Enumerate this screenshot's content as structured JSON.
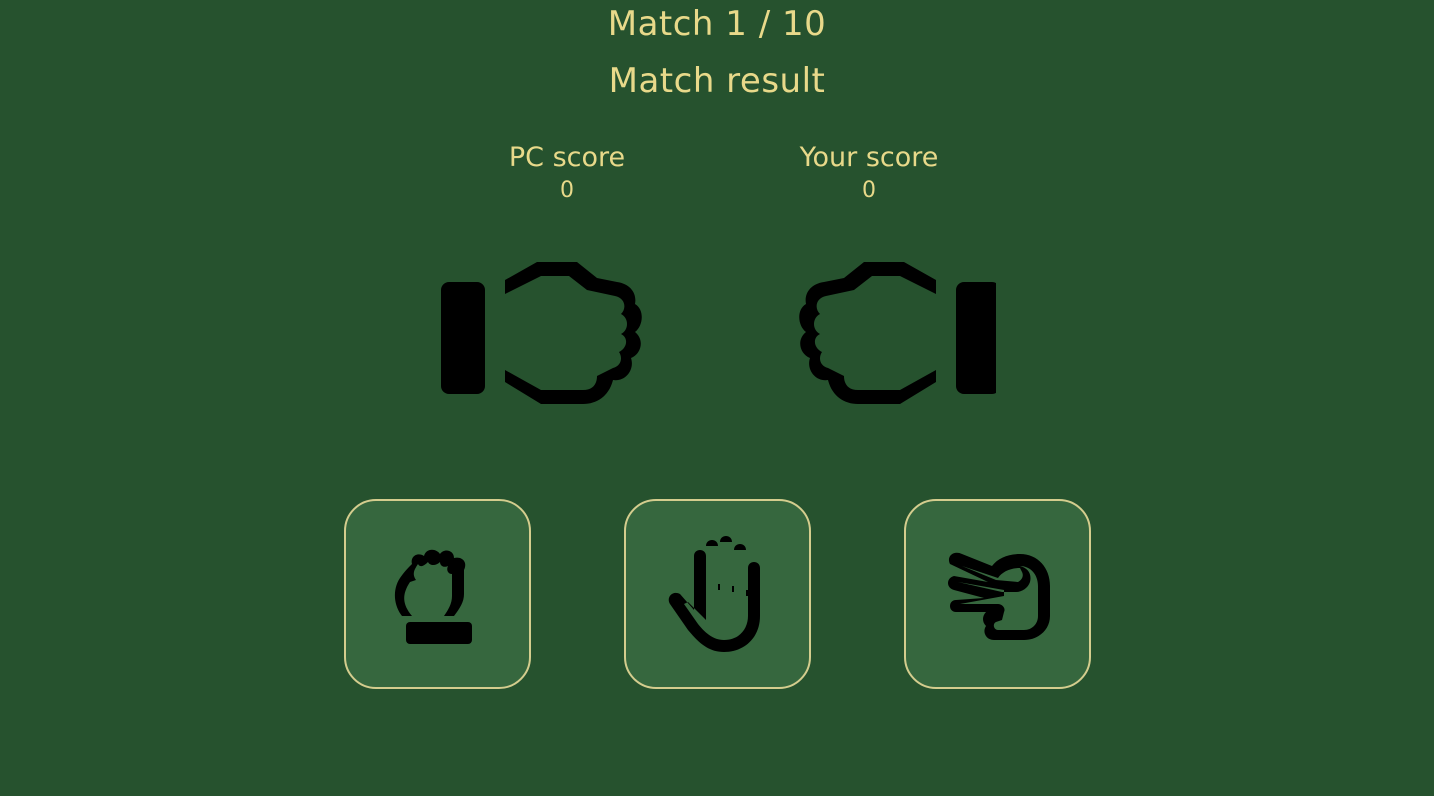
{
  "header": {
    "match_counter": "Match 1 / 10",
    "match_result": "Match result"
  },
  "scores": {
    "pc": {
      "label": "PC score",
      "value": "0"
    },
    "player": {
      "label": "Your score",
      "value": "0"
    }
  },
  "hands": {
    "pc": {
      "choice": "rock",
      "icon": "fist-icon"
    },
    "player": {
      "choice": "rock",
      "icon": "fist-icon"
    }
  },
  "choices": [
    {
      "id": "rock",
      "icon": "rock-hand-icon"
    },
    {
      "id": "paper",
      "icon": "paper-hand-icon"
    },
    {
      "id": "scissors",
      "icon": "scissors-hand-icon"
    }
  ],
  "colors": {
    "background": "#26522e",
    "text": "#e8d98a",
    "button_bg": "#36673e",
    "button_border": "#d4cd8e",
    "icon": "#000000"
  }
}
